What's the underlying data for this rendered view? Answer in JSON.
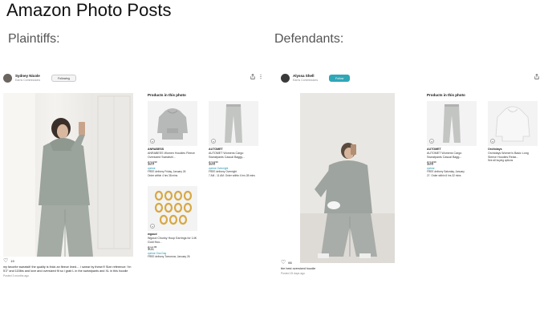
{
  "slide": {
    "title": "Amazon Photo Posts",
    "plaintiffs_label": "Plaintiffs:",
    "defendants_label": "Defendants:"
  },
  "plaintiff_post": {
    "user_name": "Sydney Nicole",
    "user_sub": "Earns Commissions",
    "follow_label": "Following",
    "products_title": "Products in this photo",
    "likes": "19",
    "caption": "my favorite sweatsit! the quality is thick an fleece lined.... i swear by these!!! Size reference: I'm 5'2\" and 115lbs and love and oversized fit so i grab L in the sweatpants and XL in this hoodie",
    "posted": "Posted 3 months ago",
    "products": [
      {
        "brand": "ANRABESS",
        "title": "ANRABESS Women Hoodies Fleece Oversized Sweatshi...",
        "price": "$39",
        "price_cents": "99",
        "prime": "vprime",
        "delivery": "FREE delivery Friday, January 26",
        "delivery2": "Order within 4 hrs 38 mins"
      },
      {
        "brand": "AUTOMET",
        "title": "AUTOMET Womens Cargo Sweatpants Casual Baggy...",
        "price": "$38",
        "price_cents": "99",
        "prime": "vprime Overnight",
        "delivery": "FREE delivery Overnight",
        "delivery2": "7 AM - 11 AM. Order within 4 hrs 28 mins"
      },
      {
        "brand": "wgoud",
        "title": "Wgoud Chunky Hoop Earrings for 14K Gold Hoo...",
        "price": "$11",
        "price_cents": "95",
        "prime": "vprime One-Day",
        "delivery": "FREE delivery Tomorrow, January 26"
      }
    ]
  },
  "defendant_post": {
    "user_name": "Alyssa Shell",
    "user_sub": "Earns Commissions",
    "follow_label": "Follow",
    "products_title": "Products in this photo",
    "likes": "66",
    "caption": "the best oversized hoodie",
    "posted": "Posted 15 days ago",
    "products": [
      {
        "brand": "AUTOMET",
        "title": "AUTOMET Womens Cargo Sweatpants Casual Bagg...",
        "price": "$38",
        "price_cents": "99",
        "prime": "vprime",
        "delivery": "FREE delivery Saturday, January",
        "delivery2": "27. Order within 6 hrs 32 mins"
      },
      {
        "brand": "Orchidays",
        "title": "Orchidays Women's Basic Long Sleeve Hoodies Relax...",
        "price": "",
        "price_cents": "",
        "prime": "",
        "delivery": "See all buying options"
      }
    ]
  },
  "icons": {
    "share": "share-icon",
    "more": "more-icon",
    "heart": "heart-icon",
    "add": "add-to-cart-icon"
  }
}
